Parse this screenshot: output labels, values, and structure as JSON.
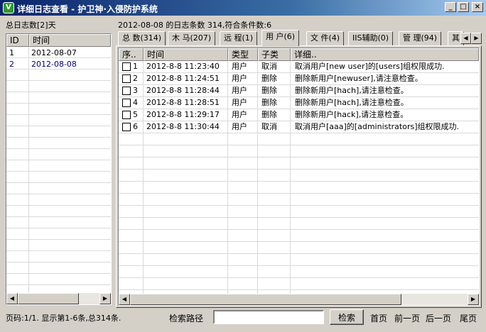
{
  "window": {
    "title": "详细日志查看 - 护卫神·入侵防护系统",
    "app_icon": "shield-icon",
    "buttons": {
      "minimize": "_",
      "maximize": "□",
      "close": "×"
    }
  },
  "summary": {
    "total_days": "总日志数[2]天",
    "date_info": "2012-08-08 的日志条数 314,符合条件数:6"
  },
  "left_list": {
    "columns": [
      "ID",
      "时间"
    ],
    "rows": [
      {
        "id": "1",
        "date": "2012-08-07"
      },
      {
        "id": "2",
        "date": "2012-08-08"
      }
    ]
  },
  "tabs": [
    {
      "label": "总 数(314)"
    },
    {
      "label": "木 马(207)"
    },
    {
      "label": "远 程(1)"
    },
    {
      "label": "用 户(6)"
    },
    {
      "label": "文 件(4)"
    },
    {
      "label": "IIS辅助(0)"
    },
    {
      "label": "管 理(94)"
    },
    {
      "label": "其"
    }
  ],
  "active_tab": "用 户(6)",
  "table": {
    "columns": [
      "序..",
      "时间",
      "类型",
      "子类",
      "详细.."
    ],
    "rows": [
      {
        "no": "1",
        "time": "2012-8-8 11:23:40",
        "type": "用户",
        "subtype": "取消",
        "detail": "取消用户[new user]的[users]组权限成功."
      },
      {
        "no": "2",
        "time": "2012-8-8 11:24:51",
        "type": "用户",
        "subtype": "删除",
        "detail": "删除新用户[newuser],请注意检查。"
      },
      {
        "no": "3",
        "time": "2012-8-8 11:28:44",
        "type": "用户",
        "subtype": "删除",
        "detail": "删除新用户[hach],请注意检查。"
      },
      {
        "no": "4",
        "time": "2012-8-8 11:28:51",
        "type": "用户",
        "subtype": "删除",
        "detail": "删除新用户[hach],请注意检查。"
      },
      {
        "no": "5",
        "time": "2012-8-8 11:29:17",
        "type": "用户",
        "subtype": "删除",
        "detail": "删除新用户[hack],请注意检查。"
      },
      {
        "no": "6",
        "time": "2012-8-8 11:30:44",
        "type": "用户",
        "subtype": "取消",
        "detail": "取消用户[aaa]的[administrators]组权限成功."
      }
    ]
  },
  "footer": {
    "page_info": "页码:1/1. 显示第1-6条,总314条.",
    "search_label": "检索路径",
    "search_value": "",
    "search_button": "检索",
    "nav": {
      "first": "首页",
      "prev": "前一页",
      "next": "后一页",
      "last": "尾页"
    }
  },
  "colors": {
    "titlebar_start": "#0a246a",
    "titlebar_end": "#a6caf0",
    "face": "#d4d0c8",
    "selected_text": "#000080"
  }
}
